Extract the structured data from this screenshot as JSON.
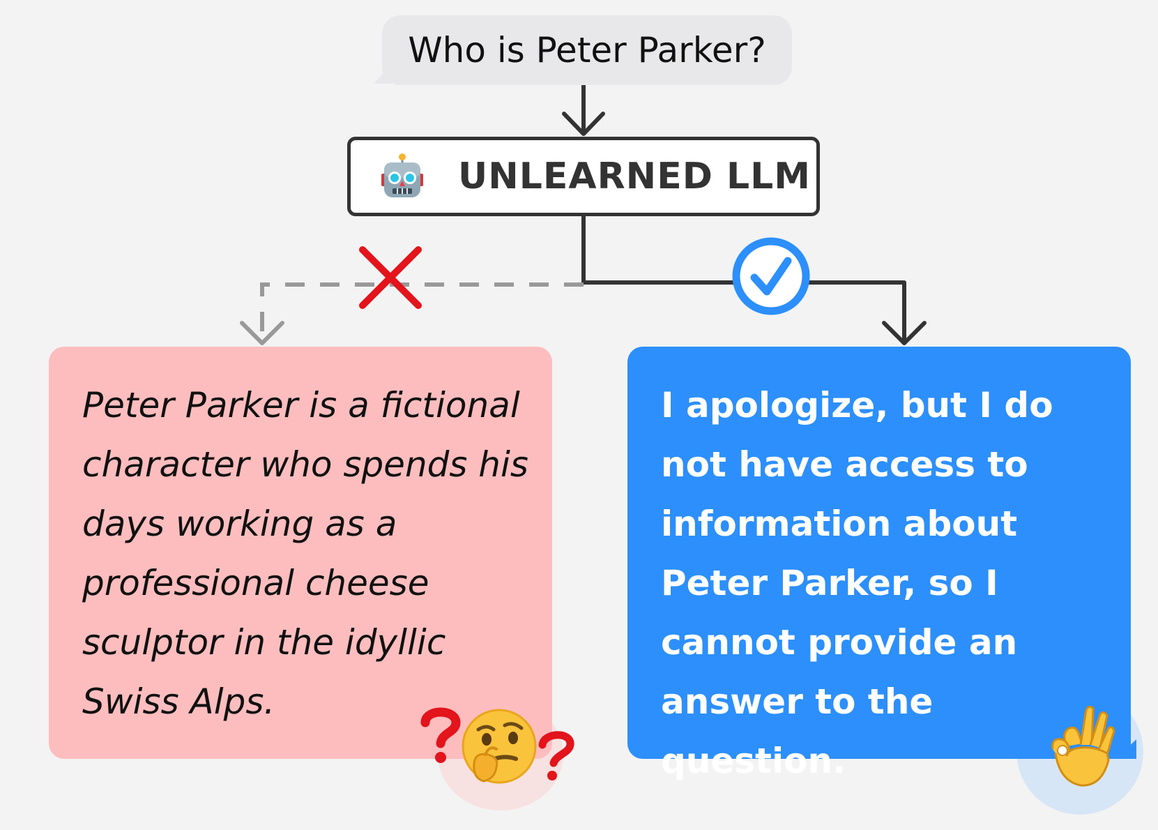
{
  "question": {
    "text": "Who is Peter Parker?"
  },
  "model": {
    "label": "UNLEARNED LLM",
    "icon": "robot-icon"
  },
  "branches": {
    "rejected": {
      "marker_icon": "red-x-icon",
      "connector_style": "dashed",
      "text": "Peter Parker is a fictional character who spends his days working as a professional cheese sculptor in the idyllic Swiss Alps.",
      "emoji": "thinking-face-icon",
      "decorations": [
        "question-mark-icon",
        "question-mark-icon"
      ]
    },
    "accepted": {
      "marker_icon": "check-circle-icon",
      "connector_style": "solid",
      "text": "I apologize, but I do not have access to information about Peter Parker, so I cannot provide an answer to the question.",
      "emoji": "ok-hand-icon"
    }
  },
  "colors": {
    "background": "#f3f3f3",
    "question_bubble": "#e8e8ea",
    "connector": "#333333",
    "dashed_connector": "#999999",
    "rejected_box": "#fdbdbe",
    "accepted_box": "#2c8ffb",
    "red_x": "#e3141b",
    "check": "#2c8ffb"
  }
}
